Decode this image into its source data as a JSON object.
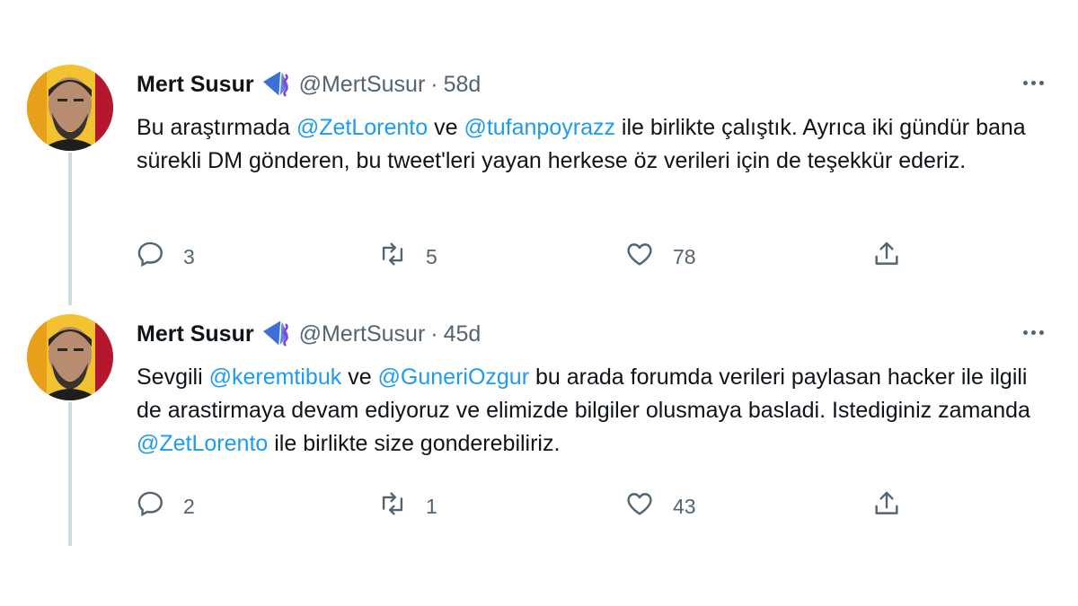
{
  "tweets": [
    {
      "author_name": "Mert Susur",
      "handle": "@MertSusur",
      "separator": "·",
      "time": "58d",
      "text_segments": [
        {
          "type": "text",
          "value": "Bu araştırmada "
        },
        {
          "type": "mention",
          "value": "@ZetLorento"
        },
        {
          "type": "text",
          "value": " ve "
        },
        {
          "type": "mention",
          "value": "@tufanpoyrazz"
        },
        {
          "type": "text",
          "value": " ile birlikte çalıştık. Ayrıca iki gündür bana sürekli DM gönderen, bu tweet'leri yayan herkese öz verileri için de teşekkür ederiz."
        }
      ],
      "reply_count": "3",
      "retweet_count": "5",
      "like_count": "78"
    },
    {
      "author_name": "Mert Susur",
      "handle": "@MertSusur",
      "separator": "·",
      "time": "45d",
      "text_segments": [
        {
          "type": "text",
          "value": "Sevgili "
        },
        {
          "type": "mention",
          "value": "@keremtibuk"
        },
        {
          "type": "text",
          "value": " ve "
        },
        {
          "type": "mention",
          "value": "@GuneriOzgur"
        },
        {
          "type": "text",
          "value": " bu arada forumda verileri paylasan hacker ile ilgili de arastirmaya devam ediyoruz ve elimizde bilgiler olusmaya basladi. Istediginiz zamanda "
        },
        {
          "type": "mention",
          "value": "@ZetLorento"
        },
        {
          "type": "text",
          "value": " ile birlikte size gonderebiliriz."
        }
      ],
      "reply_count": "2",
      "retweet_count": "1",
      "like_count": "43"
    }
  ],
  "colors": {
    "text": "#0f1419",
    "secondary": "#536471",
    "mention": "#1d9bf0",
    "thread_line": "#cfd9de"
  },
  "icons": {
    "reply": "reply-icon",
    "retweet": "retweet-icon",
    "like": "heart-icon",
    "share": "share-icon",
    "more": "more-options-icon",
    "badge": "kite-badge-icon"
  }
}
